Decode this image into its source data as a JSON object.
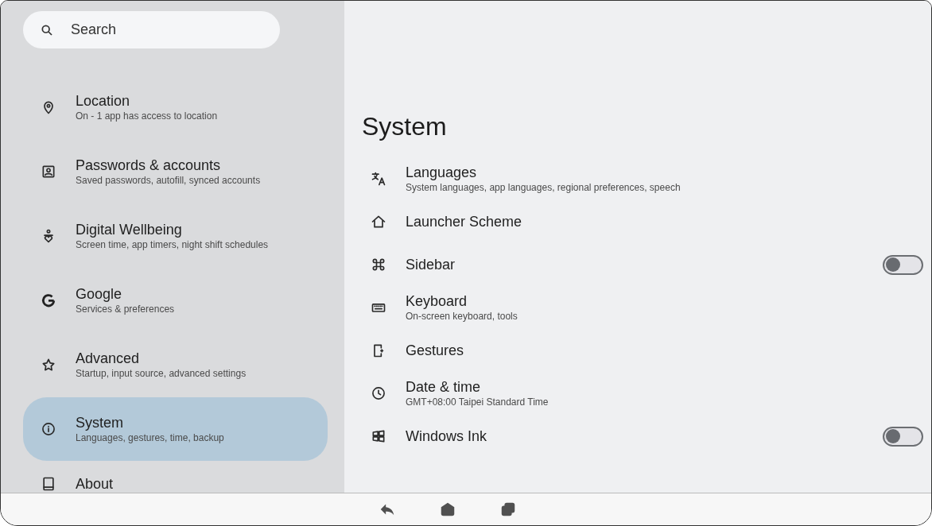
{
  "search": {
    "placeholder": "Search"
  },
  "sidebar": {
    "items": [
      {
        "title": "Location",
        "subtitle": "On - 1 app has access to location",
        "selected": false
      },
      {
        "title": "Passwords & accounts",
        "subtitle": "Saved passwords, autofill, synced accounts",
        "selected": false
      },
      {
        "title": "Digital Wellbeing",
        "subtitle": "Screen time, app timers, night shift schedules",
        "selected": false
      },
      {
        "title": "Google",
        "subtitle": "Services & preferences",
        "selected": false
      },
      {
        "title": "Advanced",
        "subtitle": "Startup, input source, advanced settings",
        "selected": false
      },
      {
        "title": "System",
        "subtitle": "Languages, gestures, time, backup",
        "selected": true
      },
      {
        "title": "About",
        "selected": false
      }
    ]
  },
  "page": {
    "title": "System",
    "items": [
      {
        "kind": "link",
        "title": "Languages",
        "subtitle": "System languages, app languages, regional preferences, speech"
      },
      {
        "kind": "link",
        "title": "Launcher Scheme"
      },
      {
        "kind": "toggle",
        "title": "Sidebar",
        "on": false
      },
      {
        "kind": "link",
        "title": "Keyboard",
        "subtitle": "On-screen keyboard, tools"
      },
      {
        "kind": "link",
        "title": "Gestures"
      },
      {
        "kind": "link",
        "title": "Date & time",
        "subtitle": "GMT+08:00 Taipei Standard Time"
      },
      {
        "kind": "toggle",
        "title": "Windows Ink",
        "on": false
      }
    ]
  }
}
